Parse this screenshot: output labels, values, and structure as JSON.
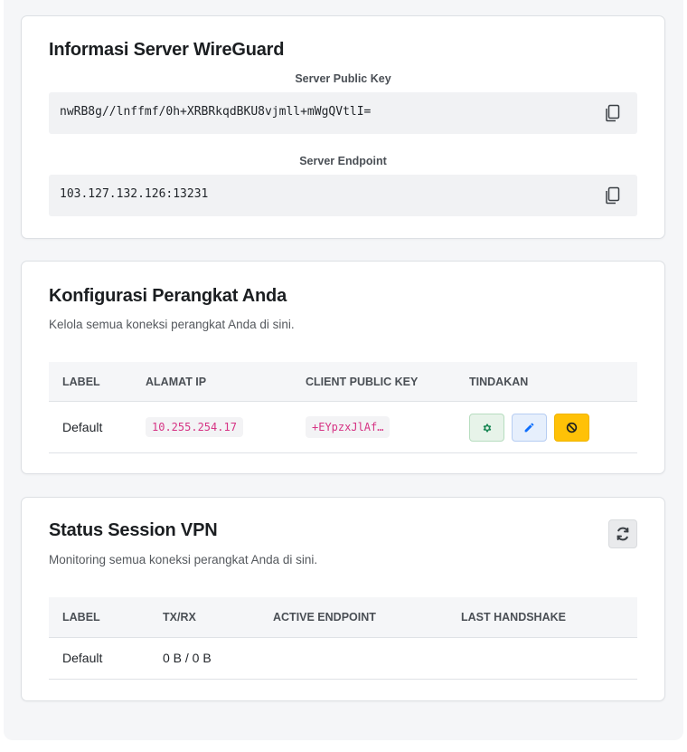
{
  "server_info": {
    "title": "Informasi Server WireGuard",
    "public_key_label": "Server Public Key",
    "public_key": "nwRB8g//lnffmf/0h+XRBRkqdBKU8vjmll+mWgQVtlI=",
    "endpoint_label": "Server Endpoint",
    "endpoint": "103.127.132.126:13231"
  },
  "devices": {
    "title": "Konfigurasi Perangkat Anda",
    "subtitle": "Kelola semua koneksi perangkat Anda di sini.",
    "columns": [
      "LABEL",
      "ALAMAT IP",
      "CLIENT PUBLIC KEY",
      "TINDAKAN"
    ],
    "rows": [
      {
        "label": "Default",
        "ip": "10.255.254.17",
        "public_key": "+EYpzxJlAf…"
      }
    ],
    "actions": {
      "settings_icon": "cog-icon",
      "edit_icon": "pencil-icon",
      "disable_icon": "ban-icon"
    },
    "colors": {
      "settings": "#198754",
      "edit": "#0d6efd",
      "disable": "#ffc107",
      "code": "#d63384"
    }
  },
  "sessions": {
    "title": "Status Session VPN",
    "subtitle": "Monitoring semua koneksi perangkat Anda di sini.",
    "refresh_icon": "refresh-icon",
    "columns": [
      "LABEL",
      "TX/RX",
      "ACTIVE ENDPOINT",
      "LAST HANDSHAKE"
    ],
    "rows": [
      {
        "label": "Default",
        "txrx": "0 B / 0 B",
        "endpoint": "",
        "handshake": ""
      }
    ]
  }
}
